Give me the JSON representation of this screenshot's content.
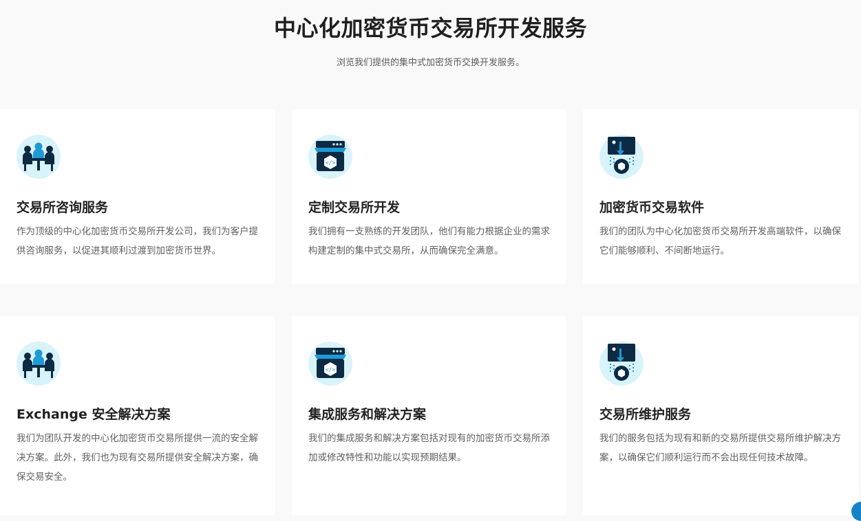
{
  "header": {
    "title": "中心化加密货币交易所开发服务",
    "subtitle": "浏览我们提供的集中式加密货币交换开发服务。"
  },
  "cards": [
    {
      "icon": "team-meeting-icon",
      "title": "交易所咨询服务",
      "desc": "作为顶级的中心化加密货币交易所开发公司，我们为客户提供咨询服务，以促进其顺利过渡到加密货币世界。"
    },
    {
      "icon": "code-store-icon",
      "title": "定制交易所开发",
      "desc": "我们拥有一支熟练的开发团队，他们有能力根据企业的需求构建定制的集中式交易所，从而确保完全满意。"
    },
    {
      "icon": "monitor-download-icon",
      "title": "加密货币交易软件",
      "desc": "我们的团队为中心化加密货币交易所开发高端软件，以确保它们能够顺利、不间断地运行。"
    },
    {
      "icon": "team-meeting-icon",
      "title": "Exchange 安全解决方案",
      "desc": "我们为团队开发的中心化加密货币交易所提供一流的安全解决方案。此外，我们也为现有交易所提供安全解决方案，确保交易安全。"
    },
    {
      "icon": "code-store-icon",
      "title": "集成服务和解决方案",
      "desc": "我们的集成服务和解决方案包括对现有的加密货币交易所添加或修改特性和功能以实现预期结果。"
    },
    {
      "icon": "monitor-download-icon",
      "title": "交易所维护服务",
      "desc": "我们的服务包括为现有和新的交易所提供交易所维护解决方案，以确保它们顺利运行而不会出现任何技术故障。"
    }
  ],
  "colors": {
    "page_bg": "#f9f9f9",
    "card_bg": "#ffffff",
    "icon_circle": "#d9f3fb",
    "icon_dark": "#0d2a44",
    "icon_accent": "#1e9ad6"
  }
}
